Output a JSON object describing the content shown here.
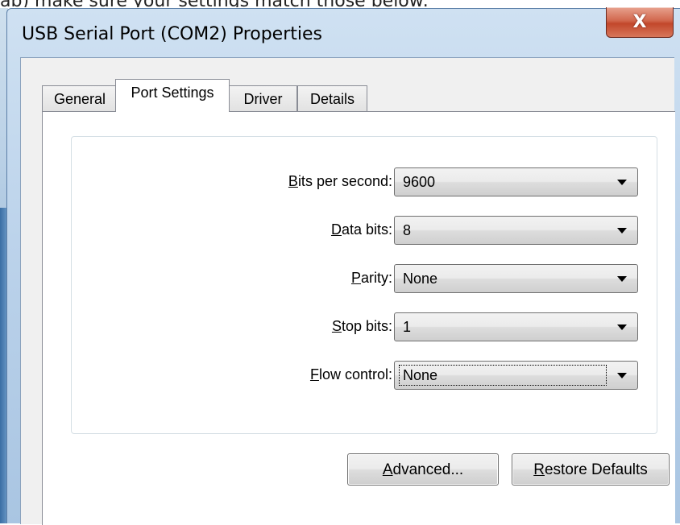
{
  "caption": {
    "text": "ab) make sure your settings match those below:"
  },
  "window": {
    "title": "USB Serial Port (COM2) Properties",
    "close_glyph": "X"
  },
  "tabs": [
    {
      "label": "General",
      "active": false
    },
    {
      "label": "Port Settings",
      "active": true
    },
    {
      "label": "Driver",
      "active": false
    },
    {
      "label": "Details",
      "active": false
    }
  ],
  "settings": [
    {
      "label_accel": "B",
      "label_rest": "its per second:",
      "value": "9600"
    },
    {
      "label_accel": "D",
      "label_rest": "ata bits:",
      "value": "8"
    },
    {
      "label_accel": "P",
      "label_rest": "arity:",
      "value": "None"
    },
    {
      "label_accel": "S",
      "label_rest": "top bits:",
      "value": "1"
    },
    {
      "label_accel": "F",
      "label_rest": "low control:",
      "value": "None",
      "focused": true
    }
  ],
  "buttons": {
    "advanced": {
      "accel": "A",
      "rest": "dvanced..."
    },
    "restore": {
      "accel": "R",
      "rest": "estore Defaults"
    }
  },
  "icons": {
    "close": "close-icon",
    "dropdown": "chevron-down-icon"
  }
}
